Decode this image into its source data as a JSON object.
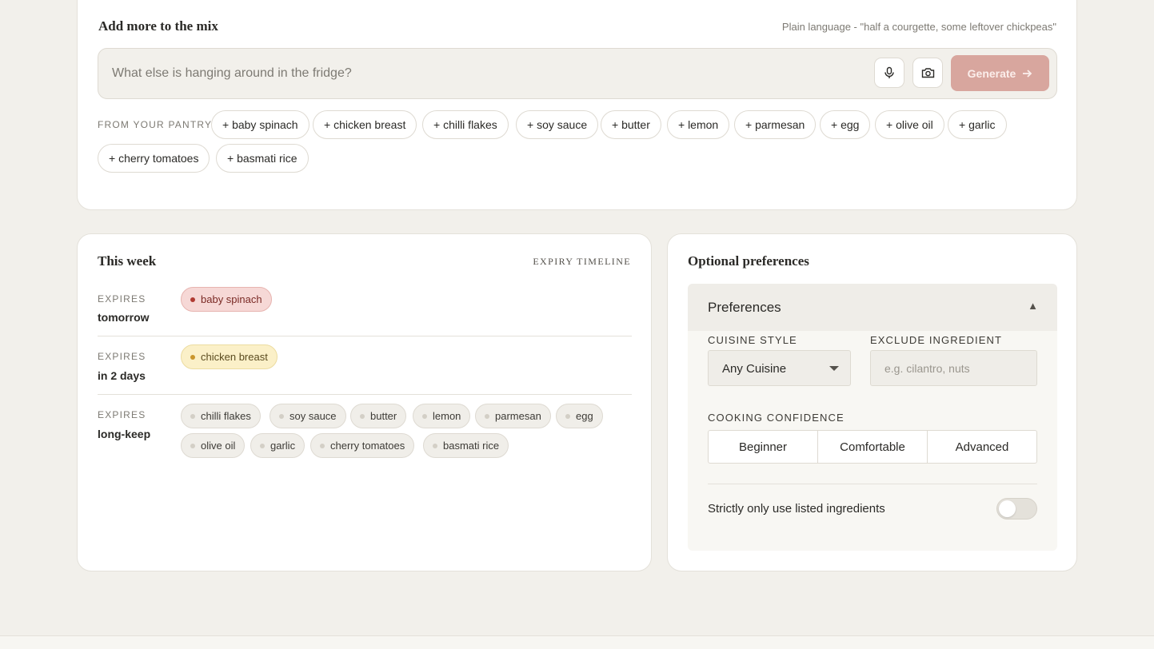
{
  "mix": {
    "title": "Add more to the mix",
    "hint": "Plain language - \"half a courgette, some leftover chickpeas\"",
    "placeholder": "What else is hanging around in the fridge?",
    "generate_label": "Generate",
    "pantry_label": "FROM YOUR PANTRY",
    "pantry": [
      "+ baby spinach",
      "+ chicken breast",
      "+ chilli flakes",
      "+ soy sauce",
      "+ butter",
      "+ lemon",
      "+ parmesan",
      "+ egg",
      "+ olive oil",
      "+ garlic",
      "+ cherry tomatoes",
      "+ basmati rice"
    ]
  },
  "week": {
    "title": "This week",
    "timeline_label": "EXPIRY TIMELINE",
    "groups": [
      {
        "label": "EXPIRES",
        "when": "tomorrow",
        "items": [
          "baby spinach"
        ]
      },
      {
        "label": "EXPIRES",
        "when": "in 2 days",
        "items": [
          "chicken breast"
        ]
      },
      {
        "label": "EXPIRES",
        "when": "long-keep",
        "items": [
          "chilli flakes",
          "soy sauce",
          "butter",
          "lemon",
          "parmesan",
          "egg",
          "olive oil",
          "garlic",
          "cherry tomatoes",
          "basmati rice"
        ]
      }
    ]
  },
  "prefs": {
    "title": "Optional preferences",
    "panel_title": "Preferences",
    "cuisine_label": "CUISINE STYLE",
    "cuisine_value": "Any Cuisine",
    "exclude_label": "EXCLUDE INGREDIENT",
    "exclude_placeholder": "e.g. cilantro, nuts",
    "confidence_label": "COOKING CONFIDENCE",
    "confidence_options": [
      "Beginner",
      "Comfortable",
      "Advanced"
    ],
    "strict_label": "Strictly only use listed ingredients",
    "strict_on": false
  },
  "colors": {
    "background": "#f2f0eb",
    "accent": "#d8a69e",
    "urgent": "#b03a32",
    "soon": "#c9962d"
  }
}
